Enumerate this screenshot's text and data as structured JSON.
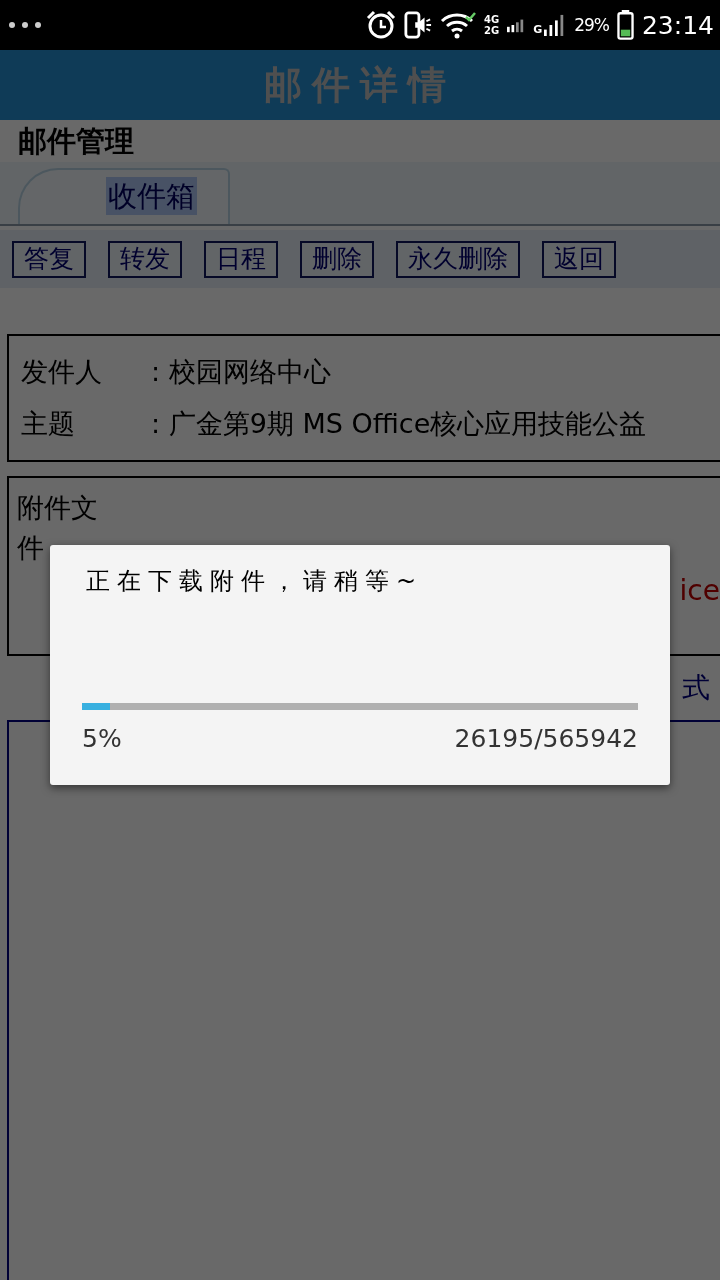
{
  "status_bar": {
    "time": "23:14",
    "battery": "29%",
    "network_labels": [
      "4G",
      "2G",
      "G"
    ]
  },
  "header": {
    "title": "邮件详情"
  },
  "section_title": "邮件管理",
  "tabs": [
    {
      "label": "收件箱",
      "selected": true
    }
  ],
  "toolbar": [
    "答复",
    "转发",
    "日程",
    "删除",
    "永久删除",
    "返回"
  ],
  "fields": [
    {
      "label": "发件人",
      "value": ": 校园网络中心"
    },
    {
      "label": "主题",
      "value": ": 广金第9期 MS Office核心应用技能公益"
    }
  ],
  "attachments": {
    "label": "附件文件",
    "link": "ice"
  },
  "format_label": "式",
  "dialog": {
    "message": "正在下载附件，请稍等~",
    "level": 0.05,
    "percent": "5%",
    "count": "26195/565942"
  }
}
